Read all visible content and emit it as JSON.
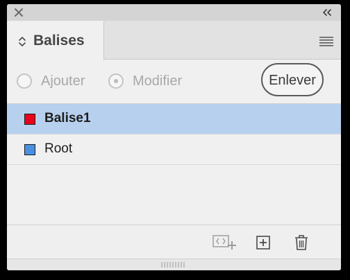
{
  "window": {
    "close_icon": "close-x-icon",
    "collapse_icon": "double-chevron-left-icon"
  },
  "tab": {
    "label": "Balises",
    "icon": "up-down-arrows-icon"
  },
  "panel_menu_icon": "hamburger-menu-icon",
  "mode": {
    "options": [
      {
        "label": "Ajouter",
        "selected": false,
        "enabled": false
      },
      {
        "label": "Modifier",
        "selected": true,
        "enabled": false
      }
    ],
    "remove_label": "Enlever"
  },
  "tags": [
    {
      "label": "Balise1",
      "color": "#e8001c",
      "selected": true
    },
    {
      "label": "Root",
      "color": "#4a90e2",
      "selected": false
    }
  ],
  "footer": {
    "icons": [
      "new-tag-from-selection-icon",
      "add-tag-icon",
      "trash-icon"
    ]
  },
  "colors": {
    "selection": "#b7d0ee",
    "panel_bg": "#f0f0f0"
  }
}
